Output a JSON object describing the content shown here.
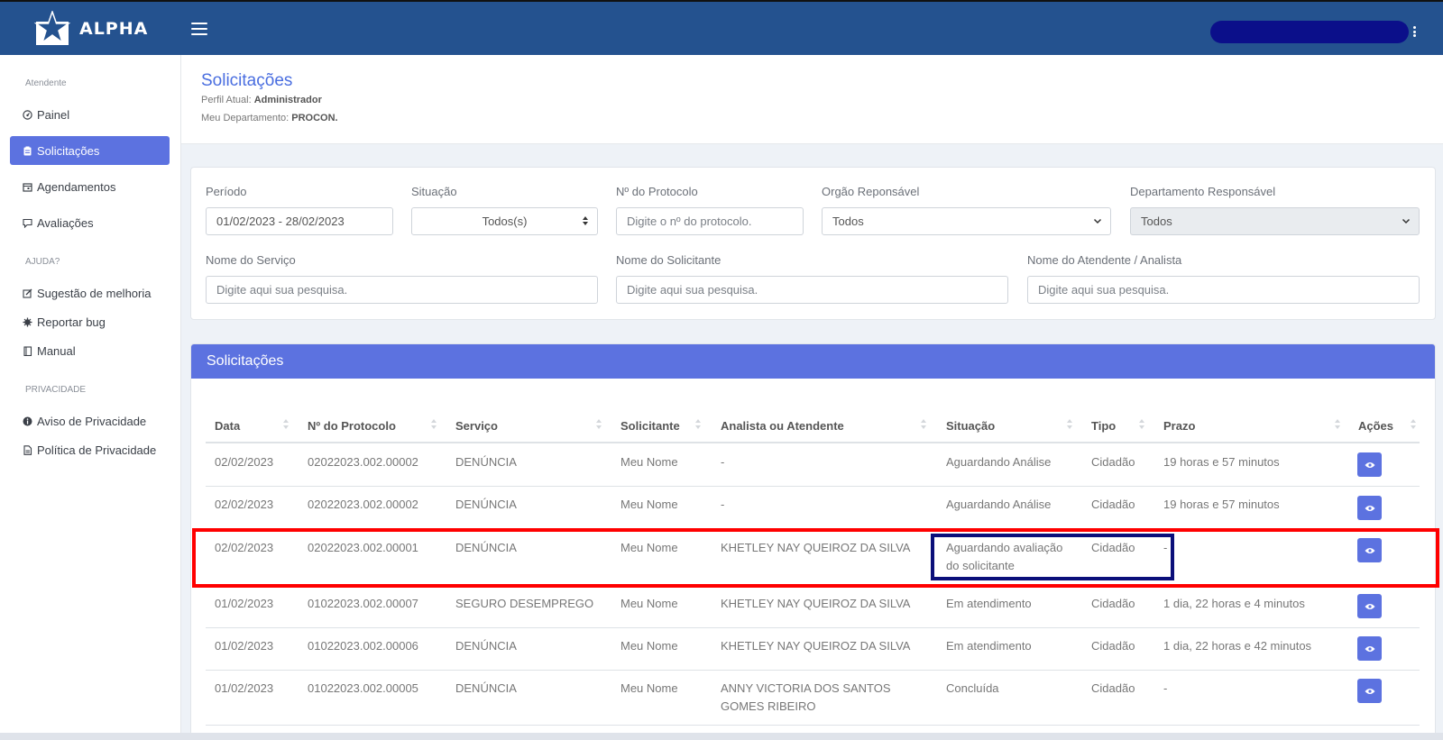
{
  "brand": {
    "name": "ALPHA"
  },
  "sidebar": {
    "heading_attendant": "Atendente",
    "heading_help": "AJUDA?",
    "heading_privacy": "PRIVACIDADE",
    "items": [
      {
        "label": "Painel",
        "icon": "dashboard-icon"
      },
      {
        "label": "Solicitações",
        "icon": "clipboard-icon"
      },
      {
        "label": "Agendamentos",
        "icon": "calendar-icon"
      },
      {
        "label": "Avaliações",
        "icon": "comment-icon"
      },
      {
        "label": "Sugestão de melhoria",
        "icon": "edit-icon"
      },
      {
        "label": "Reportar bug",
        "icon": "bug-icon"
      },
      {
        "label": "Manual",
        "icon": "book-icon"
      },
      {
        "label": "Aviso de Privacidade",
        "icon": "info-icon"
      },
      {
        "label": "Política de Privacidade",
        "icon": "document-icon"
      }
    ]
  },
  "header": {
    "title": "Solicitações",
    "profile_label": "Perfil Atual:",
    "profile_value": "Administrador",
    "dept_label": "Meu Departamento:",
    "dept_value": "PROCON."
  },
  "filters": {
    "period_label": "Período",
    "period_value": "01/02/2023 - 28/02/2023",
    "status_label": "Situação",
    "status_value": "Todos(s)",
    "protocol_label": "Nº do Protocolo",
    "protocol_placeholder": "Digite o nº do protocolo.",
    "organ_label": "Orgão Reponsável",
    "organ_value": "Todos",
    "dept_label": "Departamento Responsável",
    "dept_value": "Todos",
    "service_label": "Nome do Serviço",
    "service_placeholder": "Digite aqui sua pesquisa.",
    "requester_label": "Nome do Solicitante",
    "requester_placeholder": "Digite aqui sua pesquisa.",
    "analyst_label": "Nome do Atendente / Analista",
    "analyst_placeholder": "Digite aqui sua pesquisa."
  },
  "table": {
    "title": "Solicitações",
    "columns": [
      "Data",
      "Nº do Protocolo",
      "Serviço",
      "Solicitante",
      "Analista ou Atendente",
      "Situação",
      "Tipo",
      "Prazo",
      "Ações"
    ],
    "rows": [
      {
        "data": "02/02/2023",
        "protocolo": "02022023.002.00002",
        "servico": "DENÚNCIA",
        "solicitante": "Meu Nome",
        "analista": "-",
        "situacao": "Aguardando Análise",
        "tipo": "Cidadão",
        "prazo": "19 horas e 57 minutos"
      },
      {
        "data": "02/02/2023",
        "protocolo": "02022023.002.00002",
        "servico": "DENÚNCIA",
        "solicitante": "Meu Nome",
        "analista": "-",
        "situacao": "Aguardando Análise",
        "tipo": "Cidadão",
        "prazo": "19 horas e 57 minutos"
      },
      {
        "data": "02/02/2023",
        "protocolo": "02022023.002.00001",
        "servico": "DENÚNCIA",
        "solicitante": "Meu Nome",
        "analista": "KHETLEY NAY QUEIROZ DA SILVA",
        "situacao": "Aguardando avaliação do solicitante",
        "tipo": "Cidadão",
        "prazo": "-"
      },
      {
        "data": "01/02/2023",
        "protocolo": "01022023.002.00007",
        "servico": "SEGURO DESEMPREGO",
        "solicitante": "Meu Nome",
        "analista": "KHETLEY NAY QUEIROZ DA SILVA",
        "situacao": "Em atendimento",
        "tipo": "Cidadão",
        "prazo": "1 dia, 22 horas e 4 minutos"
      },
      {
        "data": "01/02/2023",
        "protocolo": "01022023.002.00006",
        "servico": "DENÚNCIA",
        "solicitante": "Meu Nome",
        "analista": "KHETLEY NAY QUEIROZ DA SILVA",
        "situacao": "Em atendimento",
        "tipo": "Cidadão",
        "prazo": "1 dia, 22 horas e 42 minutos"
      },
      {
        "data": "01/02/2023",
        "protocolo": "01022023.002.00005",
        "servico": "DENÚNCIA",
        "solicitante": "Meu Nome",
        "analista": "ANNY VICTORIA DOS SANTOS GOMES RIBEIRO",
        "situacao": "Concluída",
        "tipo": "Cidadão",
        "prazo": "-"
      }
    ]
  },
  "colors": {
    "topbar": "#24528f",
    "accent": "#5c72e0",
    "highlight_red": "#ff0000",
    "highlight_navy": "#0b0f7a"
  }
}
